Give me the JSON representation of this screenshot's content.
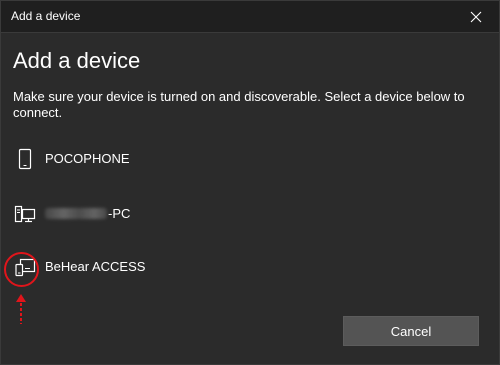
{
  "window": {
    "title": "Add a device"
  },
  "main": {
    "heading": "Add a device",
    "description": "Make sure your device is turned on and discoverable. Select a device below to connect."
  },
  "devices": [
    {
      "name": "POCOPHONE",
      "icon": "phone-icon"
    },
    {
      "name": "-PC",
      "name_obscured": true,
      "icon": "desktop-computer-icon"
    },
    {
      "name": "BeHear ACCESS",
      "icon": "audio-device-icon"
    }
  ],
  "annotation": {
    "highlight_color": "#e0151b",
    "highlighted_icon": "audio-device-icon"
  },
  "footer": {
    "cancel_label": "Cancel"
  },
  "colors": {
    "titlebar_bg": "#1f1f1f",
    "dialog_bg": "#2b2b2b",
    "button_bg": "#545454",
    "text": "#ffffff"
  }
}
